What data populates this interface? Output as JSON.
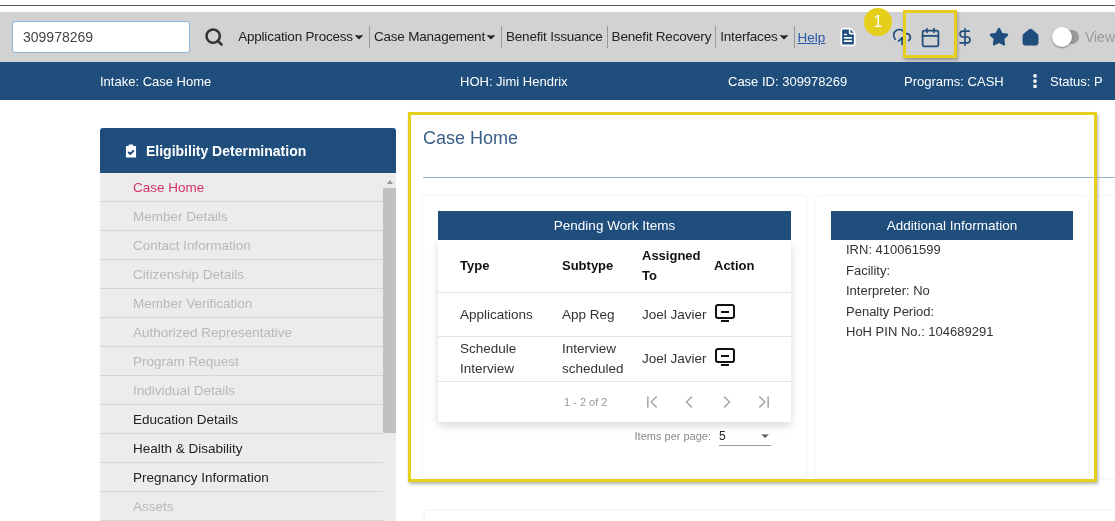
{
  "search": {
    "value": "309978269"
  },
  "menu": [
    {
      "label": "Application Process",
      "kind": "dropdown"
    },
    {
      "label": "Case Management",
      "kind": "dropdown"
    },
    {
      "label": "Benefit Issuance",
      "kind": "item"
    },
    {
      "label": "Benefit Recovery",
      "kind": "item"
    },
    {
      "label": "Interfaces",
      "kind": "dropdown"
    },
    {
      "label": "Help",
      "kind": "link"
    }
  ],
  "view_toggle": {
    "label": "View",
    "on": false
  },
  "callout": {
    "number": "1"
  },
  "case_bar": [
    {
      "label": "Intake: Case Home",
      "menu": false
    },
    {
      "label": "HOH: Jimi Hendrix",
      "menu": false
    },
    {
      "label": "Case ID: 309978269",
      "menu": false
    },
    {
      "label": "Programs: CASH",
      "menu": true
    },
    {
      "label": "Status: P",
      "menu": false
    }
  ],
  "sidebar": {
    "title": "Eligibility Determination",
    "items": [
      {
        "label": "Case Home",
        "selected": true,
        "disabled": false
      },
      {
        "label": "Member Details",
        "selected": false,
        "disabled": true
      },
      {
        "label": "Contact Information",
        "selected": false,
        "disabled": true
      },
      {
        "label": "Citizenship Details",
        "selected": false,
        "disabled": true
      },
      {
        "label": "Member Verification",
        "selected": false,
        "disabled": true
      },
      {
        "label": "Authorized Representative",
        "selected": false,
        "disabled": true
      },
      {
        "label": "Program Request",
        "selected": false,
        "disabled": true
      },
      {
        "label": "Individual Details",
        "selected": false,
        "disabled": true
      },
      {
        "label": "Education Details",
        "selected": false,
        "disabled": false
      },
      {
        "label": "Health & Disability",
        "selected": false,
        "disabled": false
      },
      {
        "label": "Pregnancy Information",
        "selected": false,
        "disabled": false
      },
      {
        "label": "Assets",
        "selected": false,
        "disabled": true
      }
    ]
  },
  "main": {
    "title": "Case Home"
  },
  "pending": {
    "title": "Pending Work Items",
    "columns": [
      "Type",
      "Subtype",
      "Assigned To",
      "Action"
    ],
    "rows": [
      {
        "type": "Applications",
        "subtype": "App Reg",
        "assigned_to": "Joel Javier"
      },
      {
        "type": "Schedule Interview",
        "subtype": "Interview scheduled",
        "assigned_to": "Joel Javier"
      }
    ],
    "range": "1 - 2 of 2",
    "items_per_page_label": "Items per page:",
    "items_per_page": "5"
  },
  "additional": {
    "title": "Additional Information",
    "lines": [
      "IRN: 410061599",
      "Facility:",
      "Interpreter: No",
      "Penalty Period:",
      "HoH PIN No.: 104689291"
    ]
  }
}
